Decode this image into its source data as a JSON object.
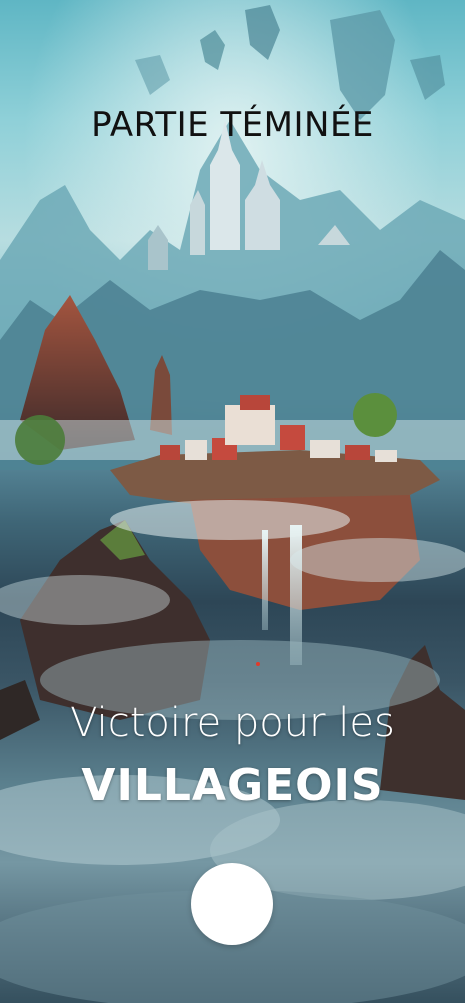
{
  "screen": {
    "title": "PARTIE TÉMINÉE",
    "result_line1": "Victoire pour les",
    "result_line2": "VILLAGEOIS"
  },
  "colors": {
    "title_text": "#111111",
    "result_text": "#ffffff",
    "button_fill": "#ffffff",
    "sky": "#8fd0d8",
    "mist": "#d9ecee"
  },
  "icons": {
    "action_button": "white-circle"
  }
}
